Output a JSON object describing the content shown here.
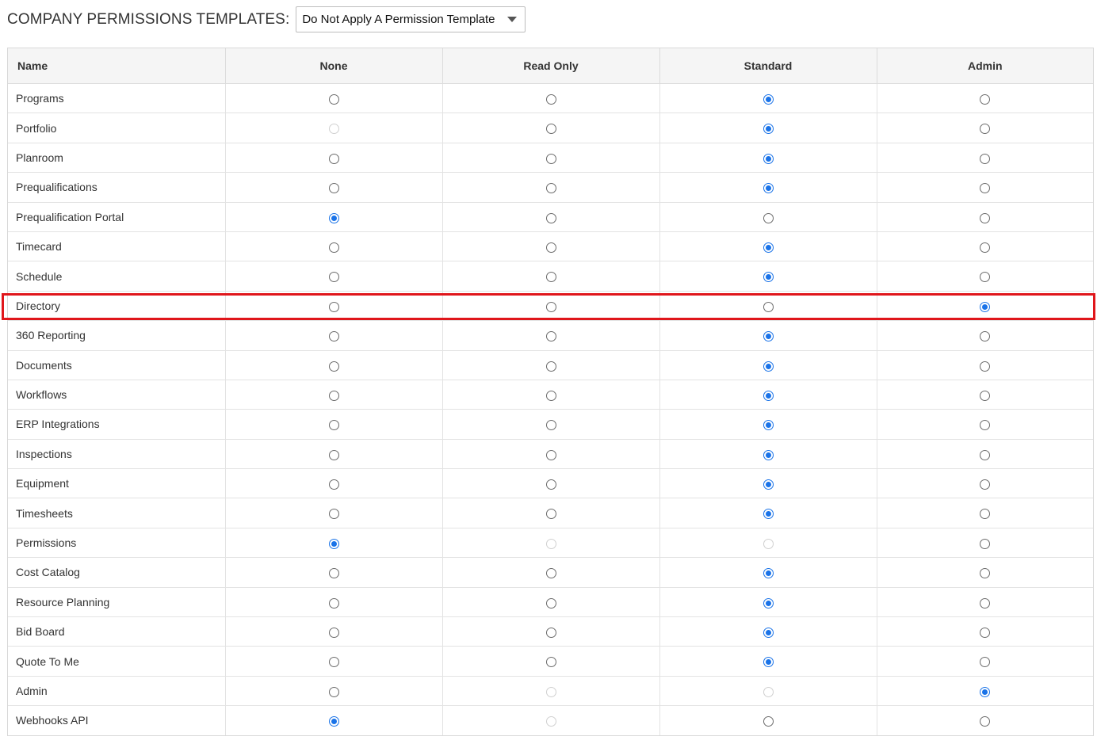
{
  "header": {
    "title": "COMPANY PERMISSIONS TEMPLATES:",
    "template_select": {
      "value": "Do Not Apply A Permission Template",
      "icon": "chevron-down-icon"
    }
  },
  "table": {
    "columns": [
      "Name",
      "None",
      "Read Only",
      "Standard",
      "Admin"
    ],
    "rows": [
      {
        "name": "Programs",
        "selected": "Standard",
        "disabled": []
      },
      {
        "name": "Portfolio",
        "selected": "Standard",
        "disabled": [
          "None"
        ]
      },
      {
        "name": "Planroom",
        "selected": "Standard",
        "disabled": []
      },
      {
        "name": "Prequalifications",
        "selected": "Standard",
        "disabled": []
      },
      {
        "name": "Prequalification Portal",
        "selected": "None",
        "disabled": []
      },
      {
        "name": "Timecard",
        "selected": "Standard",
        "disabled": []
      },
      {
        "name": "Schedule",
        "selected": "Standard",
        "disabled": []
      },
      {
        "name": "Directory",
        "selected": "Admin",
        "disabled": [],
        "highlighted": true
      },
      {
        "name": "360 Reporting",
        "selected": "Standard",
        "disabled": []
      },
      {
        "name": "Documents",
        "selected": "Standard",
        "disabled": []
      },
      {
        "name": "Workflows",
        "selected": "Standard",
        "disabled": []
      },
      {
        "name": "ERP Integrations",
        "selected": "Standard",
        "disabled": []
      },
      {
        "name": "Inspections",
        "selected": "Standard",
        "disabled": []
      },
      {
        "name": "Equipment",
        "selected": "Standard",
        "disabled": []
      },
      {
        "name": "Timesheets",
        "selected": "Standard",
        "disabled": []
      },
      {
        "name": "Permissions",
        "selected": "None",
        "disabled": [
          "Read Only",
          "Standard"
        ]
      },
      {
        "name": "Cost Catalog",
        "selected": "Standard",
        "disabled": []
      },
      {
        "name": "Resource Planning",
        "selected": "Standard",
        "disabled": []
      },
      {
        "name": "Bid Board",
        "selected": "Standard",
        "disabled": []
      },
      {
        "name": "Quote To Me",
        "selected": "Standard",
        "disabled": []
      },
      {
        "name": "Admin",
        "selected": "Admin",
        "disabled": [
          "Read Only",
          "Standard"
        ]
      },
      {
        "name": "Webhooks API",
        "selected": "None",
        "disabled": [
          "Read Only"
        ]
      }
    ]
  },
  "colors": {
    "accent": "#1a73e8",
    "highlight_border": "#e0161b",
    "header_bg": "#f5f5f5"
  }
}
